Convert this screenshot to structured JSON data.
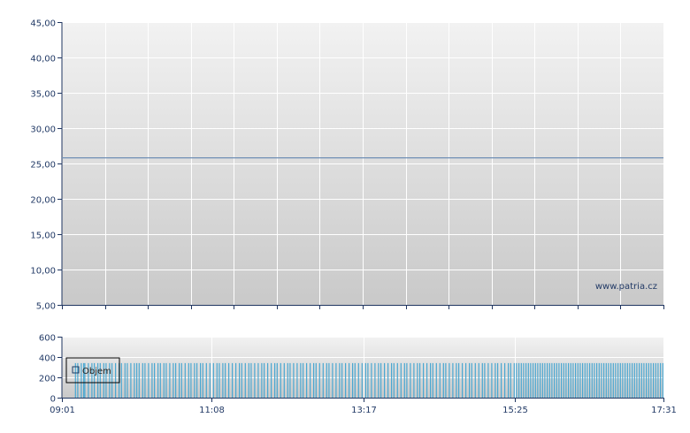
{
  "watermark": "www.patria.cz",
  "colors": {
    "price_line": "#6f8fb4",
    "axis": "#1f3560",
    "grid": "#ffffff",
    "volume_bar": "#4aa7d1",
    "bg_top": "#f2f2f2",
    "bg_bottom": "#c9c9c9"
  },
  "chart_data": [
    {
      "type": "line",
      "title": "",
      "xlabel": "",
      "ylabel": "",
      "ylim": [
        5,
        45
      ],
      "y_ticks": [
        "45,00",
        "40,00",
        "35,00",
        "30,00",
        "25,00",
        "20,00",
        "15,00",
        "10,00",
        "5,00"
      ],
      "y_tick_values": [
        45,
        40,
        35,
        30,
        25,
        20,
        15,
        10,
        5
      ],
      "x_range": [
        "09:01",
        "17:31"
      ],
      "grid": true,
      "series": [
        {
          "x": [
            "09:01",
            "17:31"
          ],
          "values": [
            25.8,
            25.8
          ]
        }
      ]
    },
    {
      "type": "bar",
      "title": "",
      "xlabel": "",
      "ylabel": "",
      "ylim": [
        0,
        600
      ],
      "y_ticks": [
        "600",
        "400",
        "200",
        "0"
      ],
      "y_tick_values": [
        600,
        400,
        200,
        0
      ],
      "x_ticks": [
        "09:01",
        "11:08",
        "13:17",
        "15:25",
        "17:31"
      ],
      "x_range": [
        "09:01",
        "17:31"
      ],
      "grid": true,
      "legend": {
        "label": "Objem",
        "placement": "top-left"
      },
      "bar_value": 340,
      "bar_times": [
        "09:12",
        "09:14",
        "09:17",
        "09:19",
        "09:20",
        "09:23",
        "09:26",
        "09:28",
        "09:31",
        "09:33",
        "09:36",
        "09:38",
        "09:41",
        "09:43",
        "09:46",
        "09:49",
        "09:51",
        "09:54",
        "09:56",
        "09:59",
        "10:02",
        "10:04",
        "10:06",
        "10:09",
        "10:11",
        "10:14",
        "10:17",
        "10:19",
        "10:22",
        "10:24",
        "10:27",
        "10:29",
        "10:32",
        "10:35",
        "10:37",
        "10:40",
        "10:42",
        "10:45",
        "10:48",
        "10:50",
        "10:53",
        "10:55",
        "10:58",
        "11:00",
        "11:03",
        "11:06",
        "11:09",
        "11:12",
        "11:14",
        "11:17",
        "11:19",
        "11:22",
        "11:25",
        "11:28",
        "11:31",
        "11:33",
        "11:36",
        "11:39",
        "11:41",
        "11:44",
        "11:47",
        "11:50",
        "11:52",
        "11:55",
        "11:58",
        "12:01",
        "12:03",
        "12:06",
        "12:09",
        "12:12",
        "12:14",
        "12:17",
        "12:20",
        "12:23",
        "12:25",
        "12:28",
        "12:31",
        "12:34",
        "12:36",
        "12:39",
        "12:42",
        "12:45",
        "12:47",
        "12:50",
        "12:53",
        "12:56",
        "12:58",
        "13:01",
        "13:04",
        "13:07",
        "13:09",
        "13:12",
        "13:15",
        "13:18",
        "13:20",
        "13:23",
        "13:26",
        "13:29",
        "13:31",
        "13:34",
        "13:37",
        "13:40",
        "13:42",
        "13:45",
        "13:48",
        "13:51",
        "13:53",
        "13:56",
        "13:59",
        "14:02",
        "14:04",
        "14:07",
        "14:10",
        "14:13",
        "14:15",
        "14:18",
        "14:21",
        "14:24",
        "14:26",
        "14:29",
        "14:32",
        "14:35",
        "14:37",
        "14:40",
        "14:43",
        "14:46",
        "14:48",
        "14:51",
        "14:54",
        "14:57",
        "14:59",
        "15:02",
        "15:05",
        "15:08",
        "15:10",
        "15:13",
        "15:16",
        "15:19",
        "15:21",
        "15:24",
        "15:26",
        "15:28",
        "15:30",
        "15:32",
        "15:34",
        "15:36",
        "15:38",
        "15:40",
        "15:42",
        "15:44",
        "15:46",
        "15:48",
        "15:50",
        "15:52",
        "15:54",
        "15:56",
        "15:58",
        "16:00",
        "16:02",
        "16:04",
        "16:06",
        "16:08",
        "16:10",
        "16:12",
        "16:14",
        "16:16",
        "16:18",
        "16:20",
        "16:22",
        "16:24",
        "16:26",
        "16:28",
        "16:30",
        "16:32",
        "16:34",
        "16:36",
        "16:38",
        "16:40",
        "16:42",
        "16:44",
        "16:46",
        "16:48",
        "16:50",
        "16:52",
        "16:54",
        "16:56",
        "16:58",
        "17:00",
        "17:02",
        "17:04",
        "17:06",
        "17:08",
        "17:10",
        "17:12",
        "17:14",
        "17:16",
        "17:18",
        "17:20",
        "17:22",
        "17:24",
        "17:26",
        "17:28",
        "17:30"
      ]
    }
  ]
}
